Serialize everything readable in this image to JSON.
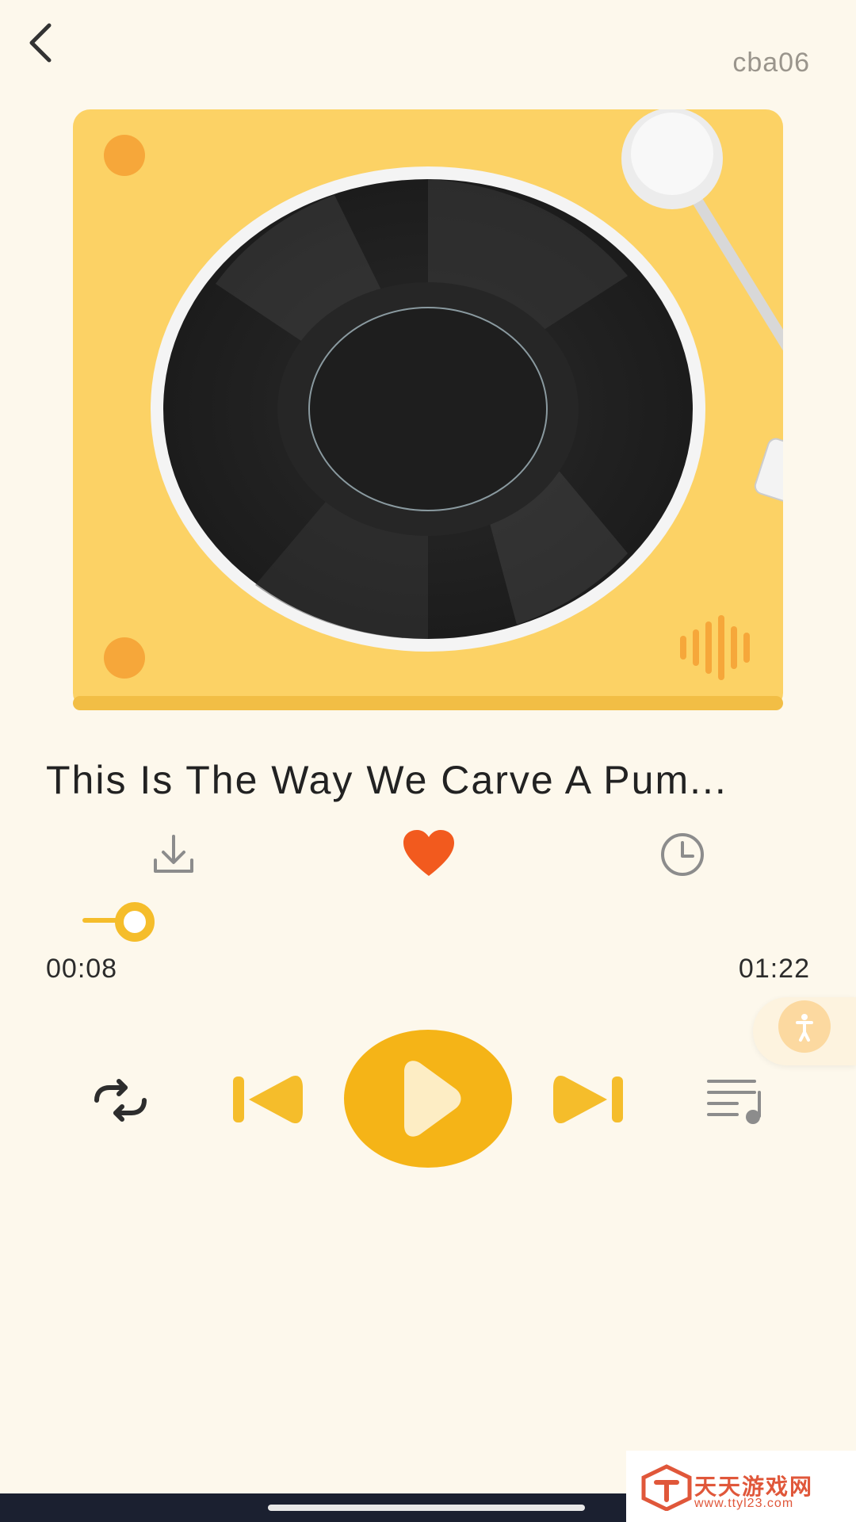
{
  "header": {
    "username": "cba06"
  },
  "song": {
    "title": "This Is The Way We Carve A Pum..."
  },
  "player": {
    "progress_fraction": 0.098,
    "elapsed": "00:08",
    "duration": "01:22",
    "liked": true
  },
  "icons": [
    "back-arrow-icon",
    "turntable-illustration",
    "download-icon",
    "heart-icon",
    "clock-icon",
    "accessibility-icon",
    "repeat-icon",
    "previous-icon",
    "play-icon",
    "next-icon",
    "playlist-icon"
  ],
  "watermark": {
    "name": "天天游戏网",
    "url": "www.ttyl23.com"
  },
  "colors": {
    "accent": "#f5bd2b",
    "heart": "#f25a1e",
    "background": "#fdf8ec",
    "card": "#fcd265"
  }
}
